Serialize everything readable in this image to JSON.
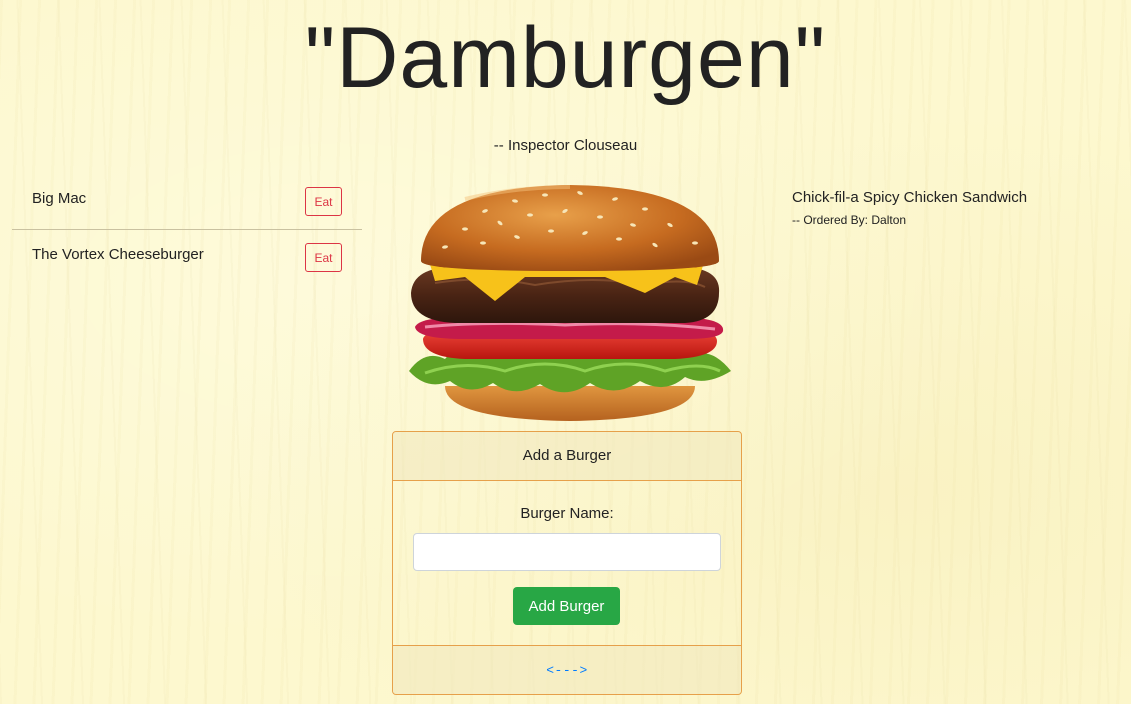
{
  "header": {
    "title": "\"Damburgen\"",
    "attribution": "-- Inspector Clouseau"
  },
  "uneaten": {
    "items": [
      {
        "name": "Big Mac",
        "button_label": "Eat"
      },
      {
        "name": "The Vortex Cheeseburger",
        "button_label": "Eat"
      }
    ]
  },
  "devoured": {
    "items": [
      {
        "name": "Chick-fil-a Spicy Chicken Sandwich",
        "ordered_by": "-- Ordered By: Dalton"
      }
    ]
  },
  "form": {
    "header": "Add a Burger",
    "field_label": "Burger Name:",
    "input_value": "",
    "submit_label": "Add Burger",
    "footer_link": "<--->"
  },
  "colors": {
    "background": "#fdf8cf",
    "eat_button": "#dc3545",
    "add_button": "#28a745",
    "card_border": "#e6a04a",
    "link": "#007bff"
  }
}
